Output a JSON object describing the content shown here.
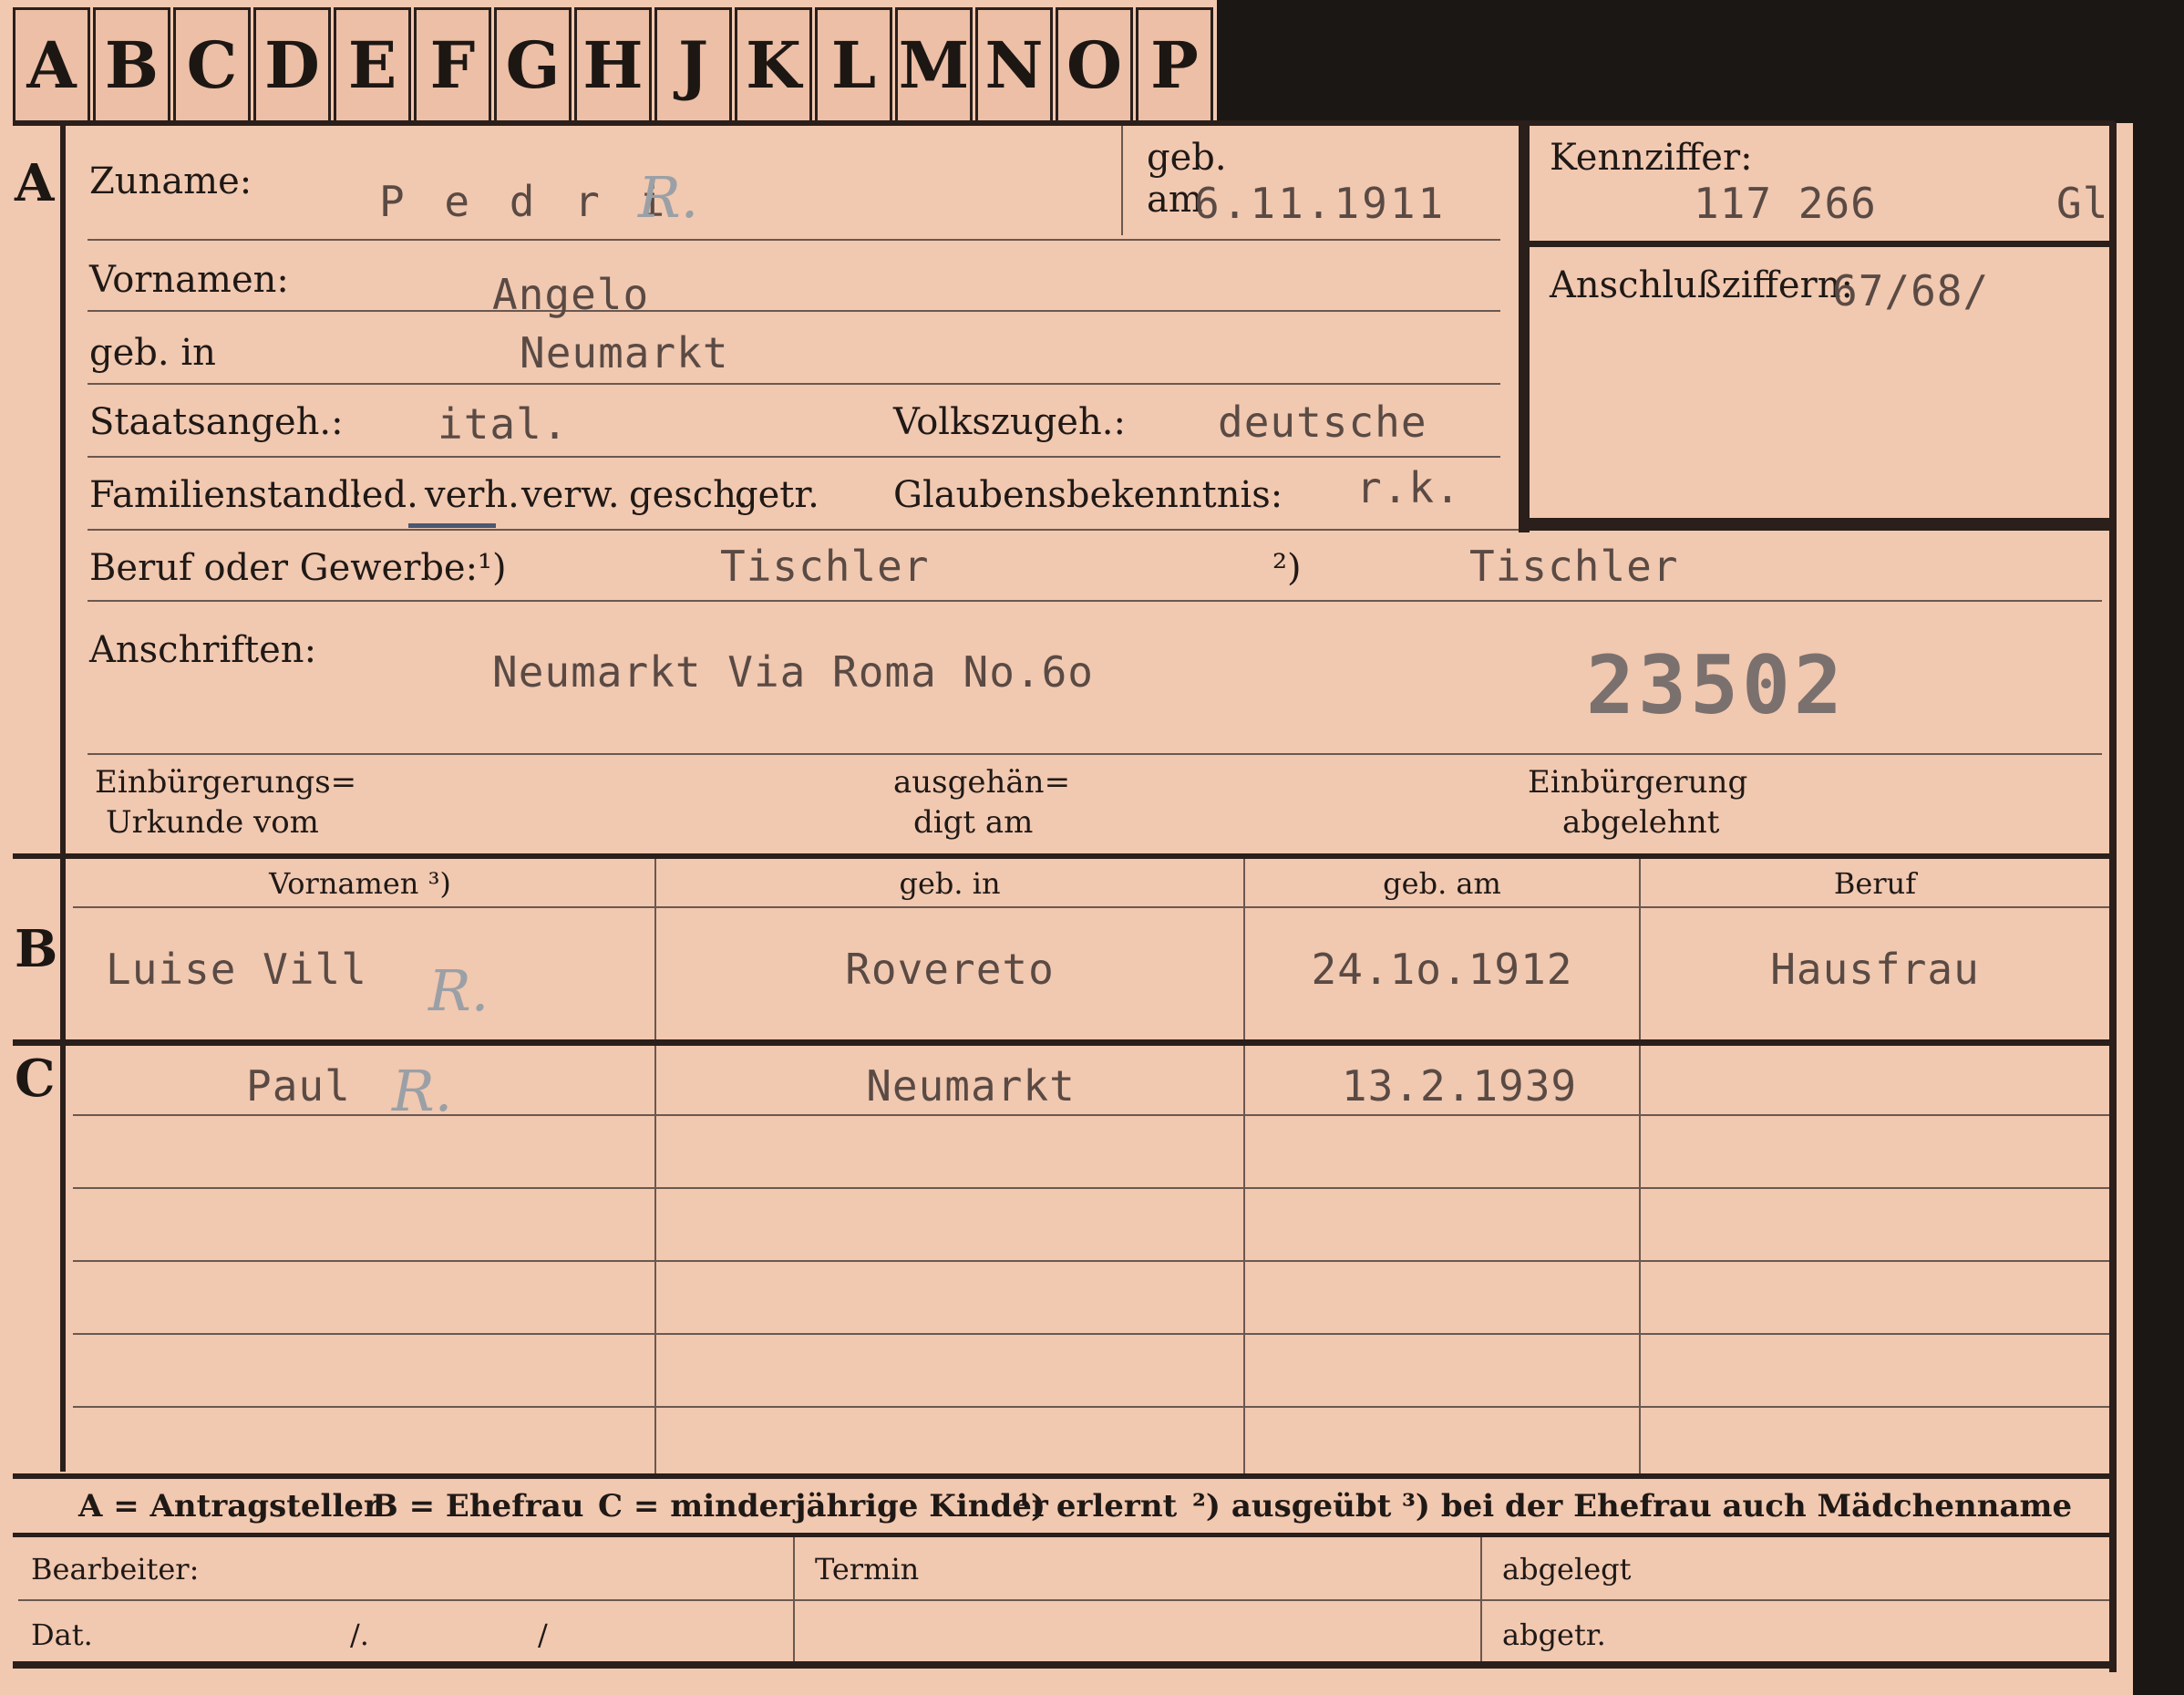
{
  "tabs": [
    "A",
    "B",
    "C",
    "D",
    "E",
    "F",
    "G",
    "H",
    "J",
    "K",
    "L",
    "M",
    "N",
    "O",
    "P"
  ],
  "sections": {
    "a": "A",
    "b": "B",
    "c": "C"
  },
  "applicant": {
    "surname_label": "Zuname:",
    "surname": "P e d r i",
    "geb_label": "geb.",
    "am_label": "am",
    "birth_date": "6.11.1911",
    "first_names_label": "Vornamen:",
    "first_names": "Angelo",
    "birthplace_label": "geb. in",
    "birthplace": "Neumarkt",
    "citizenship_label": "Staatsangeh.:",
    "citizenship": "ital.",
    "ethnicity_label": "Volkszugeh.:",
    "ethnicity": "deutsche",
    "marital_label": "Familienstand:",
    "marital_options": [
      "led.",
      "verh.",
      "verw.",
      "gesch.",
      "getr."
    ],
    "religion_label": "Glaubensbekenntnis:",
    "religion": "r.k.",
    "profession_label": "Beruf oder Gewerbe:",
    "note1": "¹)",
    "note2": "²)",
    "profession_learned": "Tischler",
    "profession_practiced": "Tischler",
    "address_label": "Anschriften:",
    "address": "Neumarkt Via Roma No.6o",
    "stamp_number": "23502",
    "naturalization_label_1": "Einbürgerungs=",
    "naturalization_label_2": "Urkunde vom",
    "handed_label_1": "ausgehän=",
    "handed_label_2": "digt am",
    "rejected_label_1": "Einbürgerung",
    "rejected_label_2": "abgelehnt"
  },
  "id_box": {
    "kennziffer_label": "Kennziffer:",
    "kennziffer": "117 266",
    "suffix": "Gl",
    "anschluss_label": "Anschlußziffern:",
    "anschluss": "67/68/"
  },
  "spouse_table": {
    "headers": [
      "Vornamen ³)",
      "geb. in",
      "geb. am",
      "Beruf"
    ],
    "row": [
      "Luise Vill",
      "Rovereto",
      "24.1o.1912",
      "Hausfrau"
    ]
  },
  "children_table": {
    "rows": [
      [
        "Paul",
        "Neumarkt",
        "13.2.1939",
        ""
      ],
      [
        "",
        "",
        "",
        ""
      ],
      [
        "",
        "",
        "",
        ""
      ],
      [
        "",
        "",
        "",
        ""
      ],
      [
        "",
        "",
        "",
        ""
      ]
    ]
  },
  "legend": {
    "a": "A = Antragsteller",
    "b": "B = Ehefrau",
    "c": "C = minderjährige Kinder",
    "n1": "¹) erlernt",
    "n2": "²) ausgeübt",
    "n3": "³) bei der Ehefrau auch Mädchenname"
  },
  "footer": {
    "bearbeiter": "Bearbeiter:",
    "dat": "Dat.",
    "slash1": "/.",
    "slash2": "/",
    "termin": "Termin",
    "abgelegt": "abgelegt",
    "abgetr": "abgetr."
  },
  "handwritten_mark": "R."
}
